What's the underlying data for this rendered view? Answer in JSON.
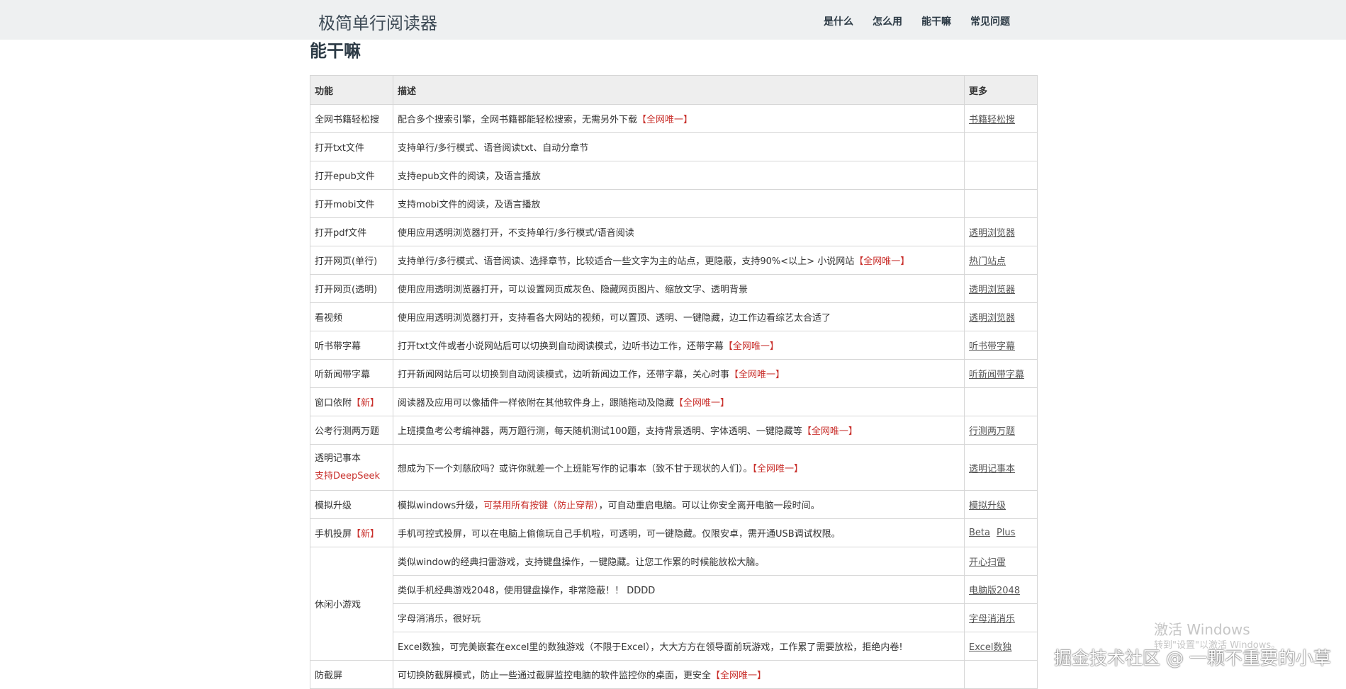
{
  "header": {
    "brand": "极简单行阅读器",
    "nav": [
      "是什么",
      "怎么用",
      "能干嘛",
      "常见问题"
    ]
  },
  "section_title": "能干嘛",
  "table": {
    "columns": [
      "功能",
      "描述",
      "更多"
    ],
    "rows": [
      {
        "feature": "全网书籍轻松搜",
        "desc": "配合多个搜索引擎，全网书籍都能轻松搜索，无需另外下载",
        "desc_tag": "【全网唯一】",
        "links": [
          "书籍轻松搜"
        ]
      },
      {
        "feature": "打开txt文件",
        "desc": "支持单行/多行模式、语音阅读txt、自动分章节",
        "links": []
      },
      {
        "feature": "打开epub文件",
        "desc": "支持epub文件的阅读，及语言播放",
        "links": []
      },
      {
        "feature": "打开mobi文件",
        "desc": "支持mobi文件的阅读，及语言播放",
        "links": []
      },
      {
        "feature": "打开pdf文件",
        "desc": "使用应用透明浏览器打开，不支持单行/多行模式/语音阅读",
        "links": [
          "透明浏览器"
        ]
      },
      {
        "feature": "打开网页(单行)",
        "desc": "支持单行/多行模式、语音阅读、选择章节，比较适合一些文字为主的站点，更隐蔽，支持90%<以上> 小说网站",
        "desc_tag": "【全网唯一】",
        "links": [
          "热门站点"
        ]
      },
      {
        "feature": "打开网页(透明)",
        "desc": "使用应用透明浏览器打开，可以设置网页成灰色、隐藏网页图片、缩放文字、透明背景",
        "links": [
          "透明浏览器"
        ]
      },
      {
        "feature": "看视频",
        "desc": "使用应用透明浏览器打开，支持看各大网站的视频，可以置顶、透明、一键隐藏，边工作边看综艺太合适了",
        "links": [
          "透明浏览器"
        ]
      },
      {
        "feature": "听书带字幕",
        "desc": "打开txt文件或者小说网站后可以切换到自动阅读模式，边听书边工作，还带字幕",
        "desc_tag": "【全网唯一】",
        "links": [
          "听书带字幕"
        ]
      },
      {
        "feature": "听新闻带字幕",
        "desc": "打开新闻网站后可以切换到自动阅读模式，边听新闻边工作，还带字幕，关心时事",
        "desc_tag": "【全网唯一】",
        "links": [
          "听新闻带字幕"
        ]
      },
      {
        "feature": "窗口依附",
        "feature_tag": "【新】",
        "desc": "阅读器及应用可以像插件一样依附在其他软件身上，跟随拖动及隐藏",
        "desc_tag": "【全网唯一】",
        "links": []
      },
      {
        "feature": "公考行测两万题",
        "desc": "上班摸鱼考公考编神器，两万题行测，每天随机测试100题，支持背景透明、字体透明、一键隐藏等",
        "desc_tag": "【全网唯一】",
        "links": [
          "行测两万题"
        ]
      },
      {
        "feature": "透明记事本",
        "feature_sub": "支持DeepSeek",
        "desc": "想成为下一个刘慈欣吗？或许你就差一个上班能写作的记事本（致不甘于现状的人们）。",
        "desc_tag": "【全网唯一】",
        "links": [
          "透明记事本"
        ]
      },
      {
        "feature": "模拟升级",
        "desc": "模拟windows升级，",
        "desc_red_mid": "可禁用所有按键（防止穿帮）",
        "desc_after": "，可自动重启电脑。可以让你安全离开电脑一段时间。",
        "links": [
          "模拟升级"
        ]
      },
      {
        "feature": "手机投屏",
        "feature_tag": "【新】",
        "desc": "手机可控式投屏，可以在电脑上偷偷玩自己手机啦，可透明，可一键隐藏。仅限安卓，需开通USB调试权限。",
        "links": [
          "Beta",
          "Plus"
        ]
      }
    ],
    "games": {
      "feature": "休闲小游戏",
      "rows": [
        {
          "desc": "类似window的经典扫雷游戏，支持键盘操作，一键隐藏。让您工作累的时候能放松大脑。",
          "links": [
            "开心扫雷"
          ]
        },
        {
          "desc": "类似手机经典游戏2048，使用键盘操作，非常隐蔽！！ DDDD",
          "links": [
            "电脑版2048"
          ]
        },
        {
          "desc": "字母消消乐，很好玩",
          "links": [
            "字母消消乐"
          ]
        },
        {
          "desc": "Excel数独，可完美嵌套在excel里的数独游戏（不限于Excel），大大方方在领导面前玩游戏，工作累了需要放松，拒绝内卷!",
          "links": [
            "Excel数独"
          ]
        }
      ]
    },
    "last_row": {
      "feature": "防截屏",
      "desc": "可切换防截屏模式，防止一些通过截屏监控电脑的软件监控你的桌面，更安全",
      "desc_tag": "【全网唯一】",
      "links": []
    }
  },
  "overlay": {
    "windows_activate": "激活 Windows",
    "windows_activate_sub": "转到\"设置\"以激活 Windows。",
    "juejin": "掘金技术社区 @ 一颗不重要的小草"
  }
}
